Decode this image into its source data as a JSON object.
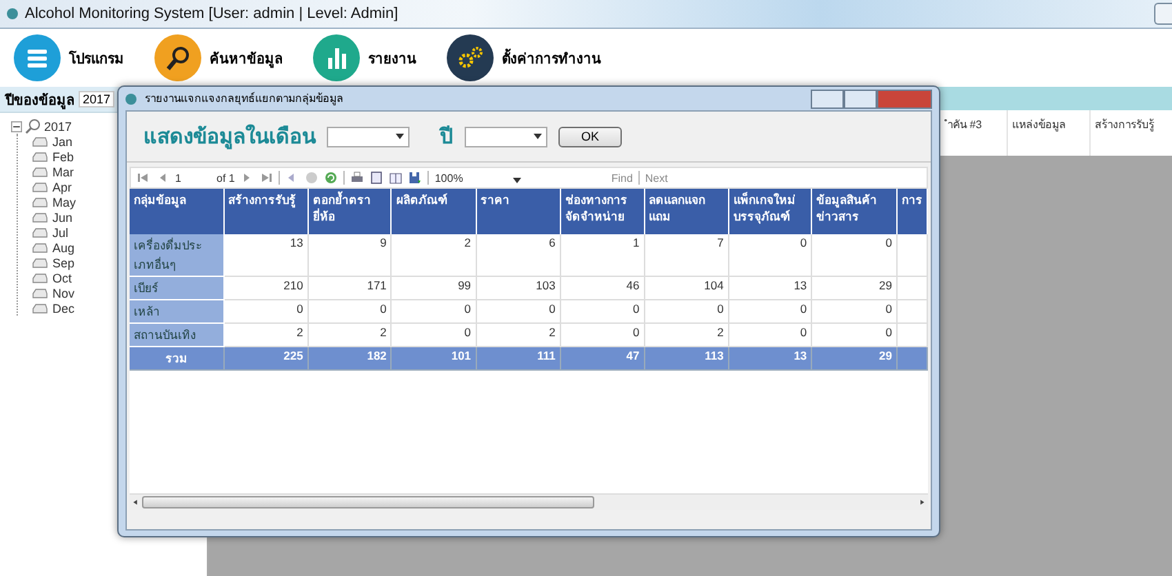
{
  "window": {
    "title": "Alcohol Monitoring System [User: admin | Level: Admin]"
  },
  "toolbar": [
    {
      "kind": "menu",
      "label": "โปรแกรม",
      "color": "#1e9fd8"
    },
    {
      "kind": "search",
      "label": "ค้นหาข้อมูล",
      "color": "#f0a020"
    },
    {
      "kind": "chart",
      "label": "รายงาน",
      "color": "#1fa98c"
    },
    {
      "kind": "gears",
      "label": "ตั้งค่าการทำงาน",
      "color": "#243a52"
    }
  ],
  "year_filter": {
    "label": "ปีของข้อมูล",
    "value": "2017"
  },
  "tree": {
    "label": "2017",
    "expanded": true,
    "children": [
      {
        "label": "Jan"
      },
      {
        "label": "Feb"
      },
      {
        "label": "Mar"
      },
      {
        "label": "Apr"
      },
      {
        "label": "May"
      },
      {
        "label": "Jun"
      },
      {
        "label": "Jul"
      },
      {
        "label": "Aug"
      },
      {
        "label": "Sep"
      },
      {
        "label": "Oct"
      },
      {
        "label": "Nov"
      },
      {
        "label": "Dec"
      }
    ]
  },
  "background_table": {
    "columns": [
      "ำคัน #3",
      "แหล่งข้อมูล",
      "สร้างการรับรู้"
    ]
  },
  "dialog": {
    "title": "รายงานแจกแจงกลยุทธ์แยกตามกลุ่มข้อมูล",
    "filter": {
      "month_label": "แสดงข้อมูลในเดือน",
      "year_label": "ปี",
      "ok": "OK"
    },
    "report_toolbar": {
      "page": "1",
      "page_of": "of 1",
      "zoom": "100%",
      "find": "Find",
      "next": "Next"
    },
    "table": {
      "columns": [
        "กลุ่มข้อมูล",
        "สร้างการรับรู้",
        "ตอกย้ำตรายี่ห้อ",
        "ผลิตภัณฑ์",
        "ราคา",
        "ช่องทางการจัดจำหน่าย",
        "ลดแลกแจกแถม",
        "แพ็กเกจใหม่บรรจุภัณฑ์",
        "ข้อมูลสินค้าข่าวสาร",
        "การ"
      ],
      "rows": [
        {
          "group": "เครื่องดื่มประเภทอื่นๆ",
          "values": [
            "13",
            "9",
            "2",
            "6",
            "1",
            "7",
            "0",
            "0"
          ]
        },
        {
          "group": "เบียร์",
          "values": [
            "210",
            "171",
            "99",
            "103",
            "46",
            "104",
            "13",
            "29"
          ]
        },
        {
          "group": "เหล้า",
          "values": [
            "0",
            "0",
            "0",
            "0",
            "0",
            "0",
            "0",
            "0"
          ]
        },
        {
          "group": "สถานบันเทิง",
          "values": [
            "2",
            "2",
            "0",
            "2",
            "0",
            "2",
            "0",
            "0"
          ]
        }
      ],
      "total": {
        "label": "รวม",
        "values": [
          "225",
          "182",
          "101",
          "111",
          "47",
          "113",
          "13",
          "29"
        ]
      }
    }
  }
}
